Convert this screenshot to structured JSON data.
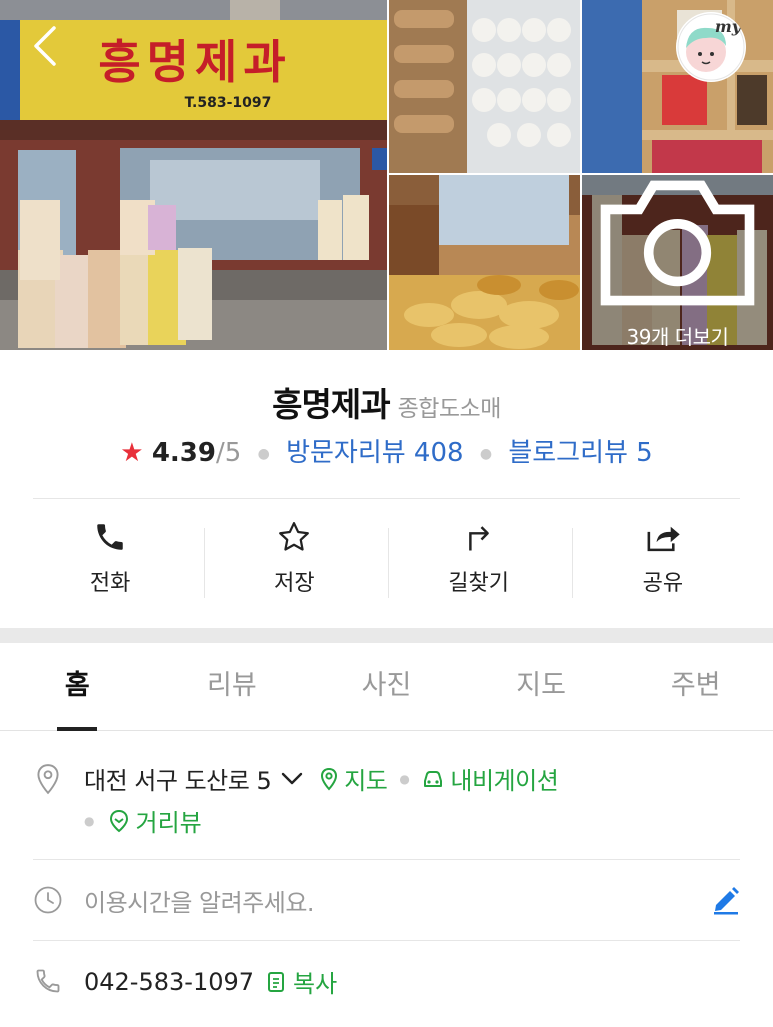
{
  "photos": {
    "main_sign_title": "흥명제과",
    "main_sign_phone": "T.583-1097",
    "more_label": "39개 더보기"
  },
  "header": {
    "avatar_badge": "my"
  },
  "place": {
    "name": "흥명제과",
    "category": "종합도소매",
    "rating": "4.39",
    "rating_max": "/5",
    "visitor_reviews": "방문자리뷰 408",
    "blog_reviews": "블로그리뷰 5"
  },
  "actions": [
    {
      "label": "전화",
      "icon": "phone-icon"
    },
    {
      "label": "저장",
      "icon": "star-outline-icon"
    },
    {
      "label": "길찾기",
      "icon": "directions-icon"
    },
    {
      "label": "공유",
      "icon": "share-icon"
    }
  ],
  "tabs": [
    "홈",
    "리뷰",
    "사진",
    "지도",
    "주변"
  ],
  "active_tab": "홈",
  "info": {
    "address": "대전 서구 도산로 5",
    "map_link": "지도",
    "navigation_link": "내비게이션",
    "street_view_link": "거리뷰",
    "hours_placeholder": "이용시간을 알려주세요.",
    "phone": "042-583-1097",
    "copy_label": "복사"
  },
  "colors": {
    "star_red": "#e8303a",
    "link_blue": "#2f6cc8",
    "link_green": "#25a541",
    "edit_blue": "#1f7ae6"
  }
}
